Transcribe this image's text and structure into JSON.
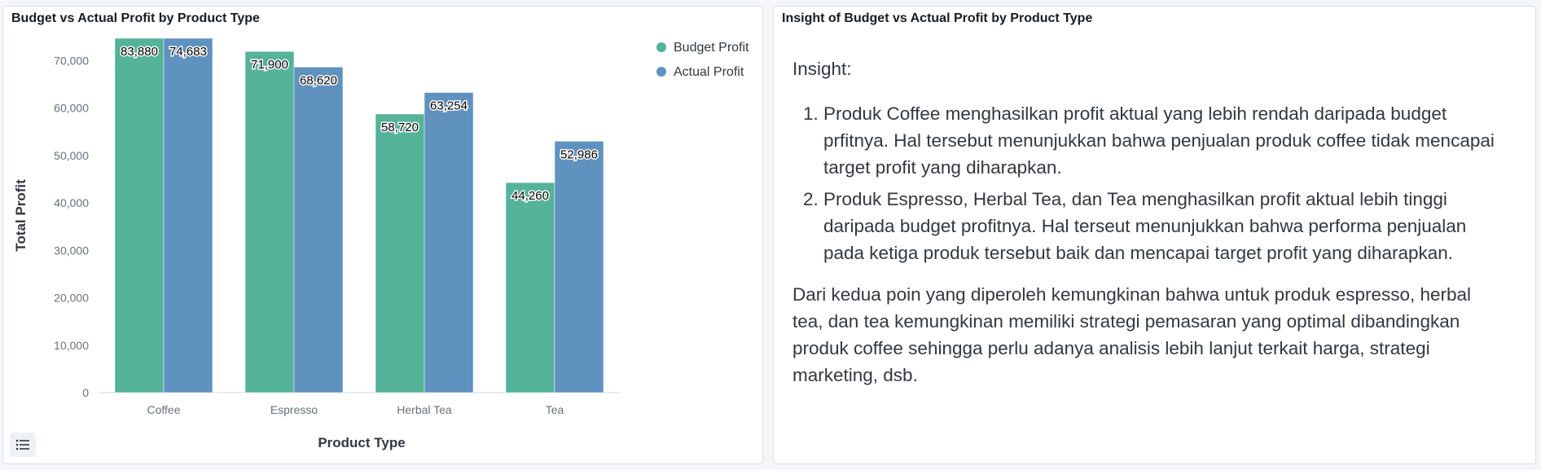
{
  "chart_panel": {
    "title": "Budget vs Actual Profit by Product Type"
  },
  "insight_panel": {
    "title": "Insight of Budget vs Actual Profit by Product Type",
    "heading": "Insight:",
    "points": [
      "Produk Coffee menghasilkan profit aktual yang lebih rendah daripada budget prfitnya. Hal tersebut menunjukkan bahwa penjualan produk coffee tidak mencapai target profit yang diharapkan.",
      "Produk Espresso, Herbal Tea, dan Tea menghasilkan profit aktual lebih tinggi daripada budget profitnya. Hal terseut menunjukkan bahwa performa penjualan pada ketiga produk tersebut baik dan mencapai target profit yang diharapkan."
    ],
    "closing": "Dari kedua poin yang diperoleh kemungkinan bahwa untuk produk espresso, herbal tea, dan tea kemungkinan memiliki strategi pemasaran yang optimal dibandingkan produk coffee sehingga perlu adanya analisis lebih lanjut terkait harga, strategi marketing, dsb."
  },
  "icons": {
    "legend_toggle": "list-icon"
  },
  "chart_data": {
    "type": "bar",
    "title": "Budget vs Actual Profit by Product Type",
    "xlabel": "Product Type",
    "ylabel": "Total Profit",
    "categories": [
      "Coffee",
      "Espresso",
      "Herbal Tea",
      "Tea"
    ],
    "series": [
      {
        "name": "Budget Profit",
        "values": [
          83880,
          71900,
          58720,
          44260
        ],
        "labels": [
          "83,880",
          "71,900",
          "58,720",
          "44,260"
        ],
        "color": "#54b399"
      },
      {
        "name": "Actual Profit",
        "values": [
          74683,
          68620,
          63254,
          52986
        ],
        "labels": [
          "74,683",
          "68,620",
          "63,254",
          "52,986"
        ],
        "color": "#6092c0"
      }
    ],
    "ylim": [
      0,
      74683
    ],
    "yticks": [
      0,
      10000,
      20000,
      30000,
      40000,
      50000,
      60000,
      70000
    ],
    "ytick_labels": [
      "0",
      "10,000",
      "20,000",
      "30,000",
      "40,000",
      "50,000",
      "60,000",
      "70,000"
    ],
    "grid": false,
    "legend_position": "top-right"
  }
}
